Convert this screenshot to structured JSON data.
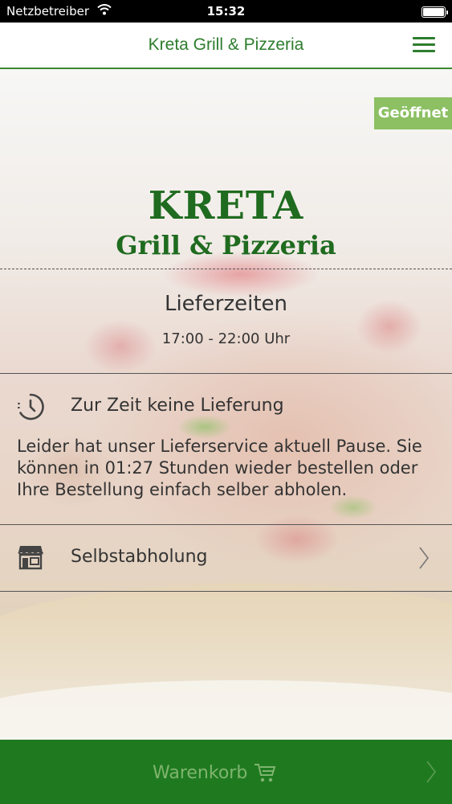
{
  "status_bar": {
    "carrier": "Netzbetreiber",
    "time": "15:32"
  },
  "nav": {
    "title": "Kreta Grill & Pizzeria",
    "menu_icon": "hamburger-menu-icon"
  },
  "badge": {
    "label": "Geöffnet",
    "color": "#8cc063"
  },
  "brand": {
    "title": "KRETA",
    "subtitle": "Grill & Pizzeria",
    "color": "#1f6b1f"
  },
  "delivery_times": {
    "heading": "Lieferzeiten",
    "hours": "17:00 - 22:00 Uhr"
  },
  "notice": {
    "icon": "clock-icon",
    "label": "Zur Zeit keine Lieferung",
    "text": "Leider hat unser Lieferservice aktuell Pause. Sie können in 01:27 Stunden wieder bestellen oder Ihre Bestellung einfach selber abholen."
  },
  "pickup": {
    "icon": "store-icon",
    "label": "Selbstabholung"
  },
  "cart": {
    "label": "Warenkorb",
    "icon": "cart-icon",
    "background": "#1f7a1f"
  }
}
